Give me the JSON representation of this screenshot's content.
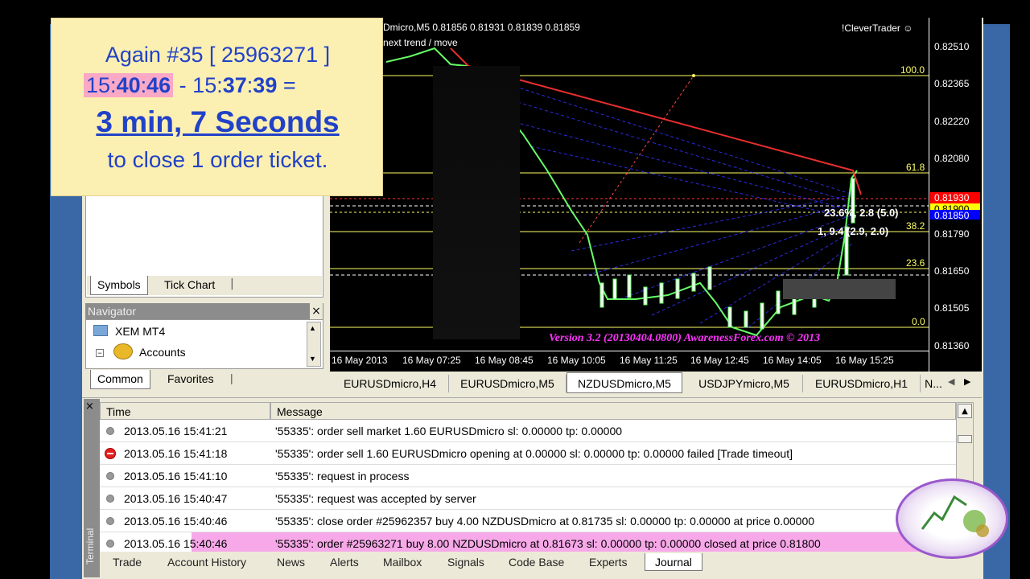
{
  "note": {
    "line1": "Again #35  [ 25963271 ]",
    "time_a_h": "15",
    "time_a_m": "40",
    "time_a_s": "46",
    "separator": " - ",
    "time_b_h": "15",
    "time_b_m": "37",
    "time_b_s": "39",
    "equals": " =",
    "duration": "3 min, 7 Seconds",
    "line4": "to close 1 order ticket."
  },
  "market_watch": {
    "tabs": [
      {
        "label": "Symbols"
      },
      {
        "label": "Tick Chart"
      }
    ]
  },
  "navigator": {
    "title": "Navigator",
    "close": "×",
    "items": [
      {
        "label": "XEM MT4"
      },
      {
        "label": "Accounts"
      }
    ],
    "tabs": [
      {
        "label": "Common"
      },
      {
        "label": "Favorites"
      }
    ]
  },
  "chart": {
    "header": "Dmicro,M5  0.81856 0.81931 0.81839 0.81859",
    "subheader": "next trend / move",
    "brand": "!CleverTrader ☺",
    "version": "Version 3.2 (20130404.0800) AwarenessForex.com © 2013",
    "prices": [
      "0.82510",
      "0.82365",
      "0.82220",
      "0.82080",
      "0.81790",
      "0.81650",
      "0.81505",
      "0.81360"
    ],
    "badge_red": "0.81930",
    "badge_yellow": "0.81900",
    "badge_blue": "0.81850",
    "times": [
      "16 May 2013",
      "16 May 07:25",
      "16 May 08:45",
      "16 May 10:05",
      "16 May 11:25",
      "16 May 12:45",
      "16 May 14:05",
      "16 May 15:25"
    ],
    "fib": {
      "l100": "100.0",
      "l618": "61.8",
      "l382": "38.2",
      "l236": "23.6",
      "l0": "0.0"
    },
    "label_a": "23.6%, 2.8 (5.0)",
    "label_b": "1, 9.4 (2.9, 2.0)",
    "colors": {
      "fib": "#ffff66",
      "up": "#66ff66",
      "down": "#ff3333",
      "trend": "#3333ff"
    }
  },
  "chart_tabs": [
    {
      "label": "EURUSDmicro,H4"
    },
    {
      "label": "EURUSDmicro,M5"
    },
    {
      "label": "NZDUSDmicro,M5"
    },
    {
      "label": "USDJPYmicro,M5"
    },
    {
      "label": "EURUSDmicro,H1"
    },
    {
      "label": "N..."
    }
  ],
  "terminal": {
    "side_label": "Terminal",
    "close": "×",
    "columns": {
      "time": "Time",
      "message": "Message"
    },
    "rows": [
      {
        "time": "2013.05.16 15:41:21",
        "message": "'55335': order sell market 1.60 EURUSDmicro sl: 0.00000 tp: 0.00000"
      },
      {
        "time": "2013.05.16 15:41:18",
        "message": "'55335': order sell 1.60 EURUSDmicro opening at 0.00000 sl: 0.00000 tp: 0.00000 failed [Trade timeout]"
      },
      {
        "time": "2013.05.16 15:41:10",
        "message": "'55335': request in process"
      },
      {
        "time": "2013.05.16 15:40:47",
        "message": "'55335': request was accepted by server"
      },
      {
        "time": "2013.05.16 15:40:46",
        "message": "'55335': close order #25962357 buy 4.00 NZDUSDmicro at 0.81735 sl: 0.00000 tp: 0.00000 at price 0.00000"
      },
      {
        "time": "2013.05.16 15:40:46",
        "message": "'55335': order #25963271 buy 8.00 NZDUSDmicro at 0.81673 sl: 0.00000 tp: 0.00000 closed at price 0.81800"
      }
    ],
    "tabs": [
      {
        "label": "Trade"
      },
      {
        "label": "Account History"
      },
      {
        "label": "News"
      },
      {
        "label": "Alerts"
      },
      {
        "label": "Mailbox"
      },
      {
        "label": "Signals"
      },
      {
        "label": "Code Base"
      },
      {
        "label": "Experts"
      },
      {
        "label": "Journal"
      }
    ]
  }
}
